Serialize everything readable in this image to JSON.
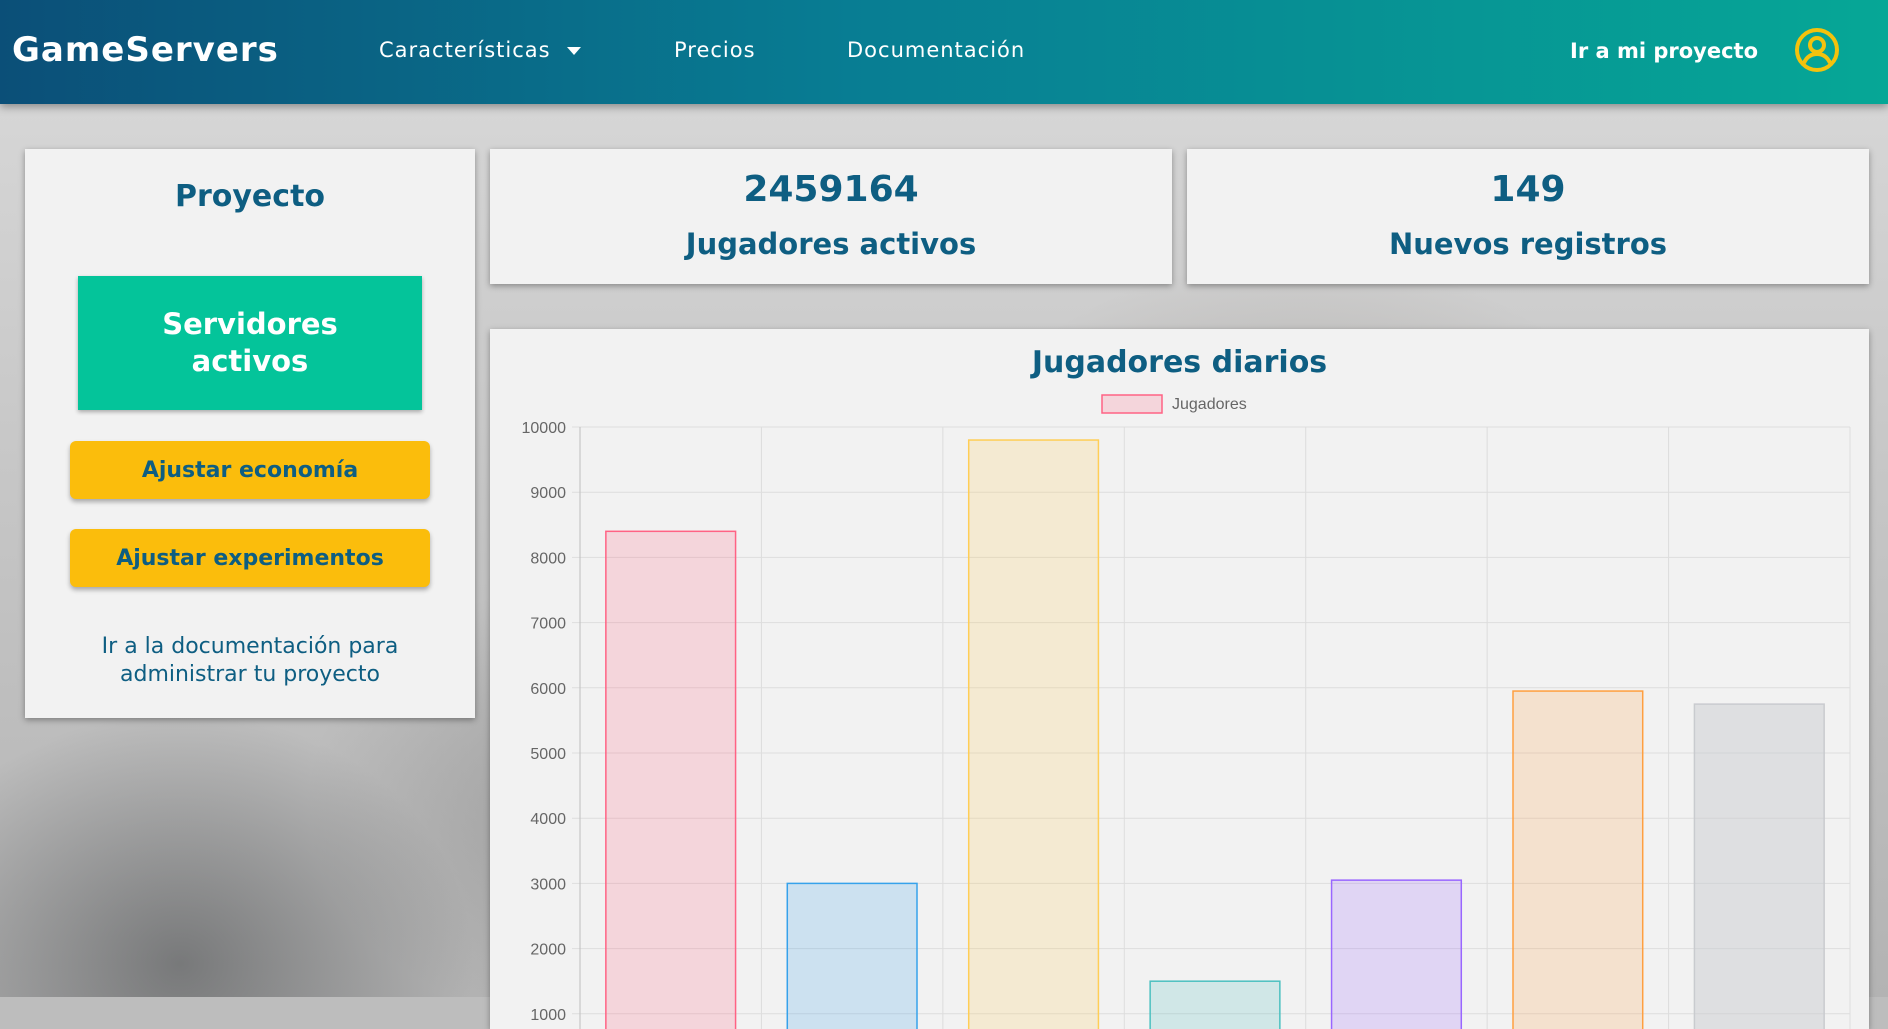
{
  "navbar": {
    "logo": "GameServers",
    "items": [
      {
        "label": "Características",
        "has_dropdown": true
      },
      {
        "label": "Precios"
      },
      {
        "label": "Documentación"
      }
    ],
    "project_link": "Ir a mi proyecto",
    "user_icon": "user-circle-icon"
  },
  "sidebar": {
    "title": "Proyecto",
    "active_servers_button": "Servidores activos",
    "adjust_economy_button": "Ajustar economía",
    "adjust_experiments_button": "Ajustar experimentos",
    "docs_link": "Ir a la documentación para administrar tu proyecto"
  },
  "stats": [
    {
      "value": "2459164",
      "label": "Jugadores activos"
    },
    {
      "value": "149",
      "label": "Nuevos registros"
    }
  ],
  "colors": {
    "brand_dark": "#0b4f78",
    "brand_teal": "#06a796",
    "accent_green": "#04c49a",
    "accent_yellow": "#fbbd0c",
    "text_blue": "#0e5e82",
    "user_icon": "#f4c20d"
  },
  "chart_data": {
    "type": "bar",
    "title": "Jugadores diarios",
    "legend": [
      "Jugadores"
    ],
    "legend_position": "top",
    "grid": true,
    "ylim": [
      0,
      10000
    ],
    "yticks": [
      1000,
      2000,
      3000,
      4000,
      5000,
      6000,
      7000,
      8000,
      9000,
      10000
    ],
    "series": [
      {
        "name": "Jugadores",
        "values": [
          8400,
          3000,
          9800,
          1500,
          3050,
          5950,
          5750
        ]
      }
    ],
    "colors": [
      {
        "fill": "rgba(255,99,132,0.2)",
        "stroke": "#ff6384"
      },
      {
        "fill": "rgba(54,162,235,0.2)",
        "stroke": "#36a2eb"
      },
      {
        "fill": "rgba(255,206,86,0.2)",
        "stroke": "#ffce56"
      },
      {
        "fill": "rgba(75,192,192,0.2)",
        "stroke": "#4bc0c0"
      },
      {
        "fill": "rgba(153,102,255,0.2)",
        "stroke": "#9966ff"
      },
      {
        "fill": "rgba(255,159,64,0.2)",
        "stroke": "#ff9f40"
      },
      {
        "fill": "rgba(201,203,207,0.5)",
        "stroke": "#c9cbcf"
      }
    ]
  }
}
